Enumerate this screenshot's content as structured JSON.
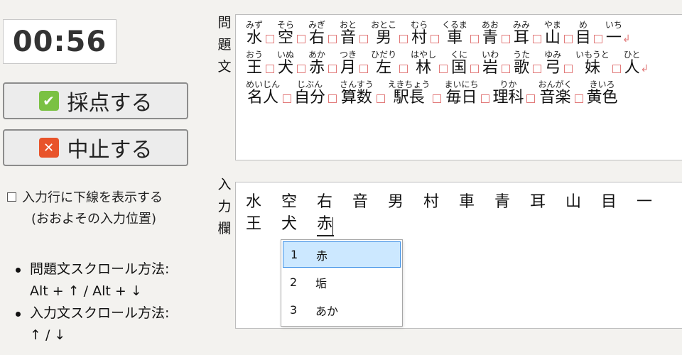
{
  "timer": "00:56",
  "buttons": {
    "grade": {
      "label": "採点する",
      "icon": "check-icon",
      "color": "#7ac143"
    },
    "stop": {
      "label": "中止する",
      "icon": "close-icon",
      "color": "#e8532a"
    }
  },
  "option": {
    "label": "入力行に下線を表示する",
    "sublabel": "(おおよその入力位置)",
    "checked": false
  },
  "help": [
    {
      "title": "問題文スクロール方法:",
      "keys": "Alt + ↑ / Alt + ↓"
    },
    {
      "title": "入力文スクロール方法:",
      "keys": "↑ / ↓"
    }
  ],
  "labels": {
    "question": [
      "問",
      "題",
      "文"
    ],
    "input": [
      "入",
      "力",
      "欄"
    ]
  },
  "question_lines": [
    [
      {
        "r": "みず",
        "k": "水"
      },
      {
        "r": "そら",
        "k": "空"
      },
      {
        "r": "みぎ",
        "k": "右"
      },
      {
        "r": "おと",
        "k": "音"
      },
      {
        "r": "おとこ",
        "k": "男"
      },
      {
        "r": "むら",
        "k": "村"
      },
      {
        "r": "くるま",
        "k": "車"
      },
      {
        "r": "あお",
        "k": "青"
      },
      {
        "r": "みみ",
        "k": "耳"
      },
      {
        "r": "やま",
        "k": "山"
      },
      {
        "r": "め",
        "k": "目"
      },
      {
        "r": "いち",
        "k": "一"
      }
    ],
    [
      {
        "r": "おう",
        "k": "王"
      },
      {
        "r": "いぬ",
        "k": "犬"
      },
      {
        "r": "あか",
        "k": "赤"
      },
      {
        "r": "つき",
        "k": "月"
      },
      {
        "r": "ひだり",
        "k": "左"
      },
      {
        "r": "はやし",
        "k": "林"
      },
      {
        "r": "くに",
        "k": "国"
      },
      {
        "r": "いわ",
        "k": "岩"
      },
      {
        "r": "うた",
        "k": "歌"
      },
      {
        "r": "ゆみ",
        "k": "弓"
      },
      {
        "r": "いもうと",
        "k": "妹"
      },
      {
        "r": "ひと",
        "k": "人"
      }
    ],
    [
      {
        "r": "めいじん",
        "k": "名人"
      },
      {
        "r": "じぶん",
        "k": "自分"
      },
      {
        "r": "さんすう",
        "k": "算数"
      },
      {
        "r": "えきちょう",
        "k": "駅長"
      },
      {
        "r": "まいにち",
        "k": "毎日"
      },
      {
        "r": "りか",
        "k": "理科"
      },
      {
        "r": "おんがく",
        "k": "音楽"
      },
      {
        "r": "きいろ",
        "k": "黄色"
      }
    ]
  ],
  "input_lines": [
    [
      "水",
      "空",
      "右",
      "音",
      "男",
      "村",
      "車",
      "青",
      "耳",
      "山",
      "目",
      "一"
    ],
    [
      "王",
      "犬",
      "赤"
    ]
  ],
  "candidates": [
    {
      "num": "1",
      "text": "赤",
      "selected": true
    },
    {
      "num": "2",
      "text": "垢",
      "selected": false
    },
    {
      "num": "3",
      "text": "あか",
      "selected": false
    }
  ],
  "colors": {
    "separator": "#e27b7b",
    "selection": "#cce8ff"
  }
}
